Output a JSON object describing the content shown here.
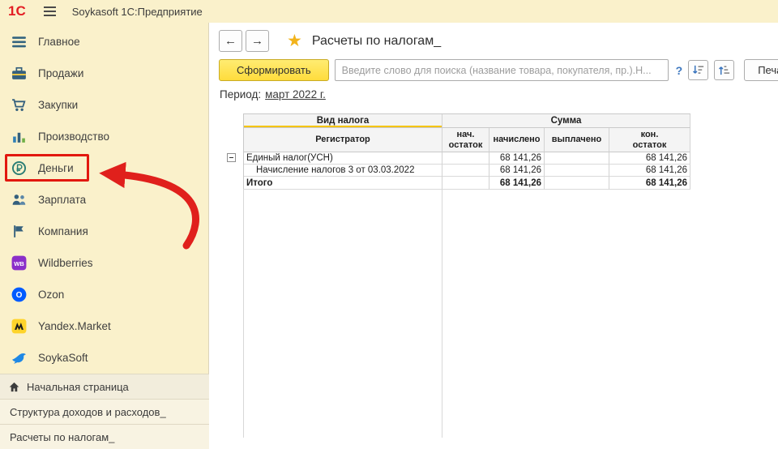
{
  "topbar": {
    "logo": "1С",
    "title": "Soykasoft 1С:Предприятие"
  },
  "icons": {
    "back": "←",
    "forward": "→",
    "star": "★"
  },
  "sidebar": {
    "items": [
      {
        "label": "Главное"
      },
      {
        "label": "Продажи"
      },
      {
        "label": "Закупки"
      },
      {
        "label": "Производство"
      },
      {
        "label": "Деньги"
      },
      {
        "label": "Зарплата"
      },
      {
        "label": "Компания"
      },
      {
        "label": "Wildberries"
      },
      {
        "label": "Ozon"
      },
      {
        "label": "Yandex.Market"
      },
      {
        "label": "SoykaSoft"
      }
    ]
  },
  "bottom_tabs": {
    "home": "Начальная страница",
    "tab1": "Структура доходов и расходов_",
    "tab2": "Расчеты по налогам_"
  },
  "main": {
    "title": "Расчеты по налогам_",
    "toolbar": {
      "generate": "Сформировать",
      "search_placeholder": "Введите слово для поиска (название товара, покупателя, пр.).Н...",
      "help": "?",
      "print": "Печать"
    },
    "period": {
      "label": "Период:",
      "value": "март 2022 г."
    },
    "table": {
      "group_headers": {
        "kind": "Вид налога",
        "sum": "Сумма"
      },
      "columns": {
        "registrar": "Регистратор",
        "start": "нач.\nостаток",
        "accrued": "начислено",
        "paid": "выплачено",
        "end": "кон.\nостаток"
      },
      "rows": [
        {
          "name": "Единый налог(УСН)",
          "accrued": "68 141,26",
          "end": "68 141,26"
        },
        {
          "name": "Начисление налогов 3 от 03.03.2022",
          "accrued": "68 141,26",
          "end": "68 141,26"
        },
        {
          "name": "Итого",
          "accrued": "68 141,26",
          "end": "68 141,26"
        }
      ]
    }
  }
}
